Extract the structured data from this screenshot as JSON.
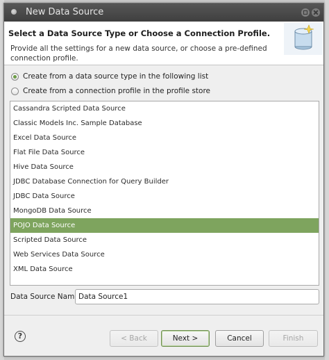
{
  "window": {
    "title": "New Data Source"
  },
  "header": {
    "title": "Select a Data Source Type or Choose a Connection Profile.",
    "description": "Provide all the settings for a new data source, or choose a pre-defined connection profile."
  },
  "options": {
    "from_type": {
      "label": "Create from a data source type in the following list",
      "checked": true
    },
    "from_profile": {
      "label": "Create from a connection profile in the profile store",
      "checked": false
    }
  },
  "data_source_types": [
    "Cassandra Scripted Data Source",
    "Classic Models Inc. Sample Database",
    "Excel Data Source",
    "Flat File Data Source",
    "Hive Data Source",
    "JDBC Database Connection for Query Builder",
    "JDBC Data Source",
    "MongoDB Data Source",
    "POJO Data Source",
    "Scripted Data Source",
    "Web Services Data Source",
    "XML Data Source"
  ],
  "selected_type": "POJO Data Source",
  "data_source_name": {
    "label": "Data Source Name:",
    "value": "Data Source1"
  },
  "buttons": {
    "help": "?",
    "back": "< Back",
    "next": "Next >",
    "cancel": "Cancel",
    "finish": "Finish"
  },
  "colors": {
    "titlebar": "#4a4a4a",
    "selection": "#7ea45e",
    "radio_accent": "#6d9d48"
  }
}
